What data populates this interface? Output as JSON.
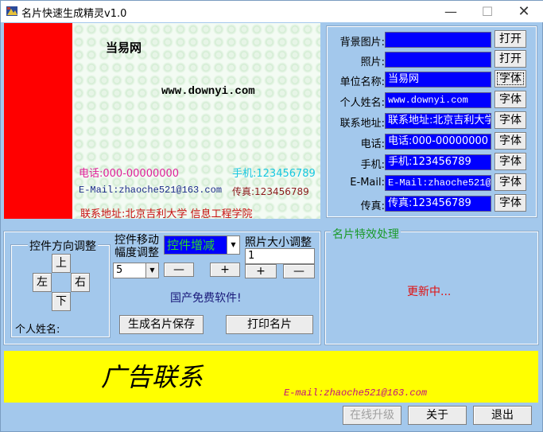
{
  "window": {
    "title": "名片快速生成精灵v1.0",
    "min": "—",
    "max": "☐",
    "close": "✕"
  },
  "card": {
    "company": "当易网",
    "name": "www.downyi.com",
    "phone": "电话:000-00000000",
    "mobile": "手机:123456789",
    "email": "E-Mail:zhaoche521@163.com",
    "fax": "传真:123456789",
    "address": "联系地址:北京吉利大学 信息工程学院"
  },
  "form": {
    "bg_label": "背景图片:",
    "photo_label": "照片:",
    "company_label": "单位名称:",
    "name_label": "个人姓名:",
    "address_label": "联系地址:",
    "phone_label": "电话:",
    "mobile_label": "手机:",
    "email_label": "E-Mail:",
    "fax_label": "传真:",
    "company_value": "当易网",
    "name_value": "www.downyi.com",
    "address_value": "联系地址:北京吉利大学",
    "phone_value": "电话:000-00000000",
    "mobile_value": "手机:123456789",
    "email_value": "E-Mail:zhaoche521@",
    "fax_value": "传真:123456789",
    "open_btn": "打开",
    "font_btn": "字体"
  },
  "controls": {
    "dir_title": "控件方向调整",
    "up": "上",
    "down": "下",
    "left": "左",
    "right": "右",
    "current_label": "个人姓名:",
    "move_title1": "控件移动",
    "move_title2": "幅度调整",
    "step_value": "5",
    "mode_value": "控件增减",
    "minus": "—",
    "plus": "+",
    "size_title": "照片大小调整",
    "size_value": "1",
    "freeware": "国产免费软件!",
    "save_btn": "生成名片保存",
    "print_btn": "打印名片"
  },
  "effects": {
    "title": "名片特效处理",
    "status": "更新中..."
  },
  "ad": {
    "text": "广告联系",
    "email": "E-mail:zhaoche521@163.com"
  },
  "footer": {
    "upgrade": "在线升级",
    "about": "关于",
    "exit": "退出"
  }
}
